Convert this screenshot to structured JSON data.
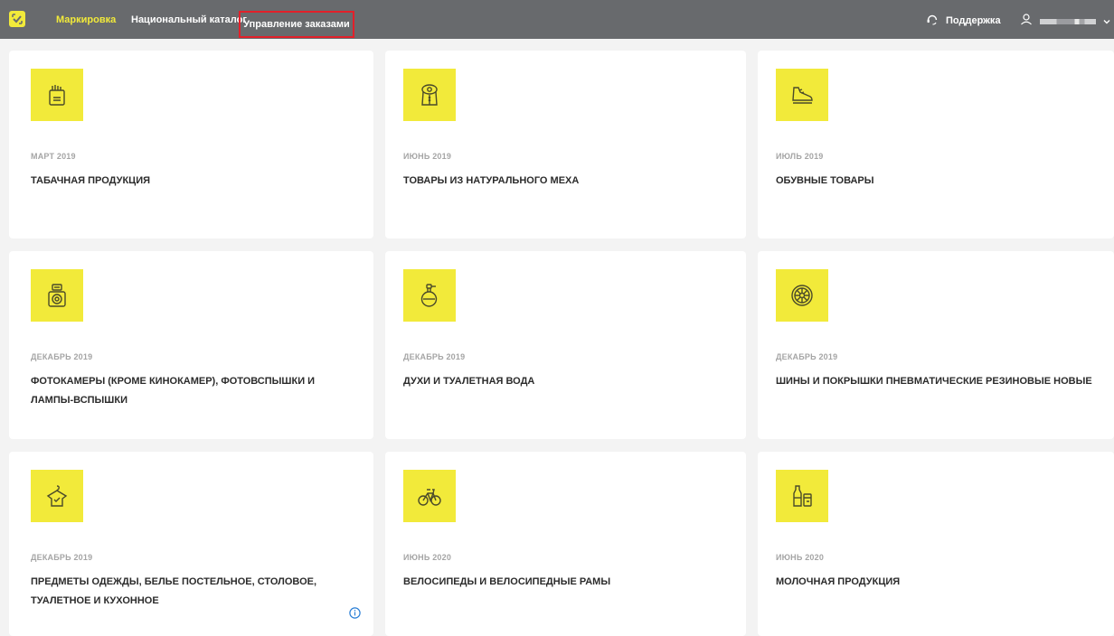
{
  "header": {
    "nav": [
      {
        "label": "Маркировка",
        "active": true
      },
      {
        "label": "Национальный каталог",
        "active": false
      },
      {
        "label": "Управление заказами",
        "active": false,
        "highlighted": true
      }
    ],
    "support_label": "Поддержка",
    "accent_color": "#f2ea3a",
    "highlight_color": "#e3202a"
  },
  "cards": [
    {
      "date": "МАРТ 2019",
      "title": "ТАБАЧНАЯ ПРОДУКЦИЯ",
      "icon": "tobacco-icon"
    },
    {
      "date": "ИЮНЬ 2019",
      "title": "ТОВАРЫ ИЗ НАТУРАЛЬНОГО МЕХА",
      "icon": "fur-coat-icon"
    },
    {
      "date": "ИЮЛЬ 2019",
      "title": "ОБУВНЫЕ ТОВАРЫ",
      "icon": "shoe-icon"
    },
    {
      "date": "ДЕКАБРЬ 2019",
      "title": "ФОТОКАМЕРЫ (КРОМЕ КИНОКАМЕР), ФОТОВСПЫШКИ И ЛАМПЫ-ВСПЫШКИ",
      "icon": "camera-icon"
    },
    {
      "date": "ДЕКАБРЬ 2019",
      "title": "ДУХИ И ТУАЛЕТНАЯ ВОДА",
      "icon": "perfume-icon"
    },
    {
      "date": "ДЕКАБРЬ 2019",
      "title": "ШИНЫ И ПОКРЫШКИ ПНЕВМАТИЧЕСКИЕ РЕЗИНОВЫЕ НОВЫЕ",
      "icon": "tire-icon"
    },
    {
      "date": "ДЕКАБРЬ 2019",
      "title": "ПРЕДМЕТЫ ОДЕЖДЫ, БЕЛЬЕ ПОСТЕЛЬНОЕ, СТОЛОВОЕ, ТУАЛЕТНОЕ И КУХОННОЕ",
      "icon": "clothes-icon"
    },
    {
      "date": "ИЮНЬ 2020",
      "title": "ВЕЛОСИПЕДЫ И ВЕЛОСИПЕДНЫЕ РАМЫ",
      "icon": "bicycle-icon"
    },
    {
      "date": "ИЮНЬ 2020",
      "title": "МОЛОЧНАЯ ПРОДУКЦИЯ",
      "icon": "dairy-icon"
    }
  ]
}
